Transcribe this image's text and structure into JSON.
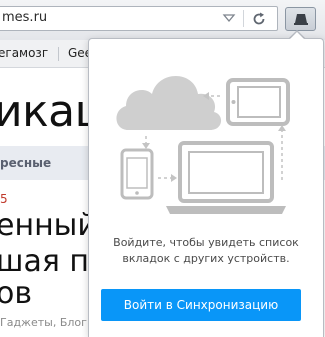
{
  "toolbar": {
    "url": "mes.ru",
    "icons": [
      "url-dropdown-icon",
      "reload-icon",
      "sync-tabs-icon"
    ]
  },
  "bookmarks": {
    "items": [
      "егамозг",
      "Gee"
    ]
  },
  "page": {
    "heading": "икац",
    "nav_label": "ресные",
    "small_mark": "5",
    "article_lines": [
      "енный т",
      "шая под",
      "ов"
    ],
    "tags": "Гаджеты, Блог"
  },
  "sync_panel": {
    "message": "Войдите, чтобы увидеть список вкладок с других устройств.",
    "signin_button": "Войти в Синхронизацию",
    "colors": {
      "button": "#0996f8",
      "illustration": "#c8c8c8"
    }
  }
}
